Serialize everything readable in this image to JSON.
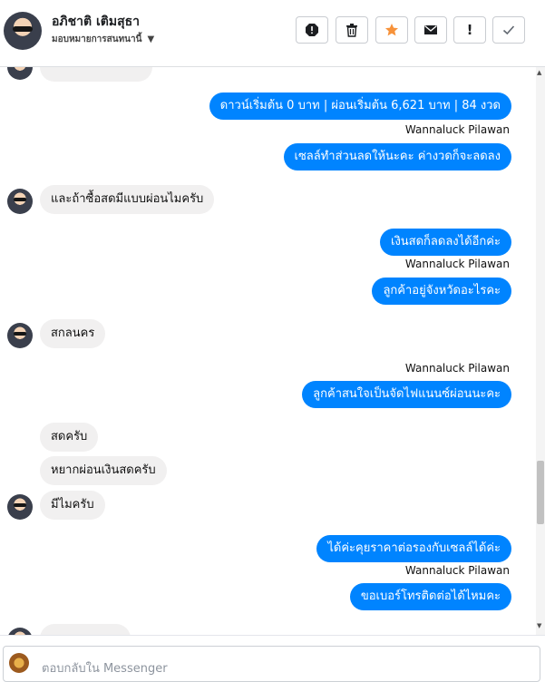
{
  "header": {
    "contact_name": "อภิชาติ เติมสุธา",
    "assign_label": "มอบหมายการสนทนานี้",
    "toolbar": [
      {
        "icon": "spam-icon"
      },
      {
        "icon": "trash-icon"
      },
      {
        "icon": "star-icon",
        "color": "#f7923a"
      },
      {
        "icon": "envelope-icon"
      },
      {
        "icon": "exclamation-icon",
        "label": "!"
      },
      {
        "icon": "check-icon"
      }
    ]
  },
  "conversation": {
    "messages": [
      {
        "dir": "out",
        "text": "ดาวน์เริ่มต้น 0 บาท | ผ่อนเริ่มต้น 6,621 บาท | 84 งวด"
      },
      {
        "dir": "sender",
        "text": "Wannaluck Pilawan"
      },
      {
        "dir": "out",
        "text": "เซลล์ทำส่วนลดให้นะคะ ค่างวดก็จะลดลง"
      },
      {
        "dir": "in",
        "text": "และถ้าซื้อสดมีแบบผ่อนไมครับ"
      },
      {
        "dir": "out",
        "text": "เงินสดก็ลดลงได้อีกค่ะ"
      },
      {
        "dir": "sender",
        "text": "Wannaluck Pilawan"
      },
      {
        "dir": "out",
        "text": "ลูกค้าอยู่จังหวัดอะไรคะ"
      },
      {
        "dir": "in",
        "text": "สกลนคร"
      },
      {
        "dir": "sender",
        "text": "Wannaluck Pilawan"
      },
      {
        "dir": "out",
        "text": "ลูกค้าสนใจเป็นจัดไฟแนนซ์ผ่อนนะคะ"
      },
      {
        "dir": "in",
        "text": "สดครับ"
      },
      {
        "dir": "in",
        "text": "หยากผ่อนเงินสดครับ"
      },
      {
        "dir": "in",
        "text": "มีไมครับ"
      },
      {
        "dir": "out",
        "text": "ได้ค่ะคุยราคาต่อรองกับเซลล์ได้ค่ะ"
      },
      {
        "dir": "sender",
        "text": "Wannaluck Pilawan"
      },
      {
        "dir": "out",
        "text": "ขอเบอร์โทรติดต่อได้ไหมคะ"
      }
    ]
  },
  "composer": {
    "placeholder": "ตอบกลับใน Messenger"
  },
  "colors": {
    "outgoing_bubble": "#0084ff",
    "incoming_bubble": "#f1f0f0",
    "star_accent": "#f7923a"
  }
}
